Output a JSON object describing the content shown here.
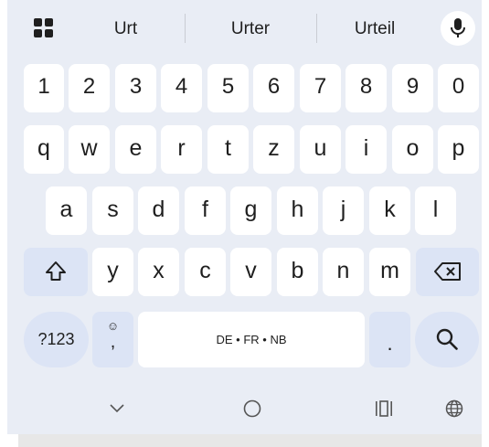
{
  "suggestions": [
    "Urt",
    "Urter",
    "Urteil"
  ],
  "keys": {
    "numbers": [
      "1",
      "2",
      "3",
      "4",
      "5",
      "6",
      "7",
      "8",
      "9",
      "0"
    ],
    "row_q": [
      "q",
      "w",
      "e",
      "r",
      "t",
      "z",
      "u",
      "i",
      "o",
      "p"
    ],
    "row_a": [
      "a",
      "s",
      "d",
      "f",
      "g",
      "h",
      "j",
      "k",
      "l"
    ],
    "row_y": [
      "y",
      "x",
      "c",
      "v",
      "b",
      "n",
      "m"
    ],
    "symbols_label": "?123",
    "emoji_label": "☺",
    "comma_label": ",",
    "space_label": "DE • FR • NB",
    "period_label": "."
  },
  "icons": {
    "apps": "apps-grid-icon",
    "mic": "microphone-icon",
    "shift": "shift-icon",
    "backspace": "backspace-icon",
    "search": "search-icon",
    "nav_hide": "chevron-down-icon",
    "nav_home": "home-circle-icon",
    "nav_recent": "recent-apps-icon",
    "nav_language": "globe-icon"
  },
  "colors": {
    "keyboard_bg": "#e9edf5",
    "key_bg": "#ffffff",
    "special_key_bg": "#dce4f5"
  }
}
